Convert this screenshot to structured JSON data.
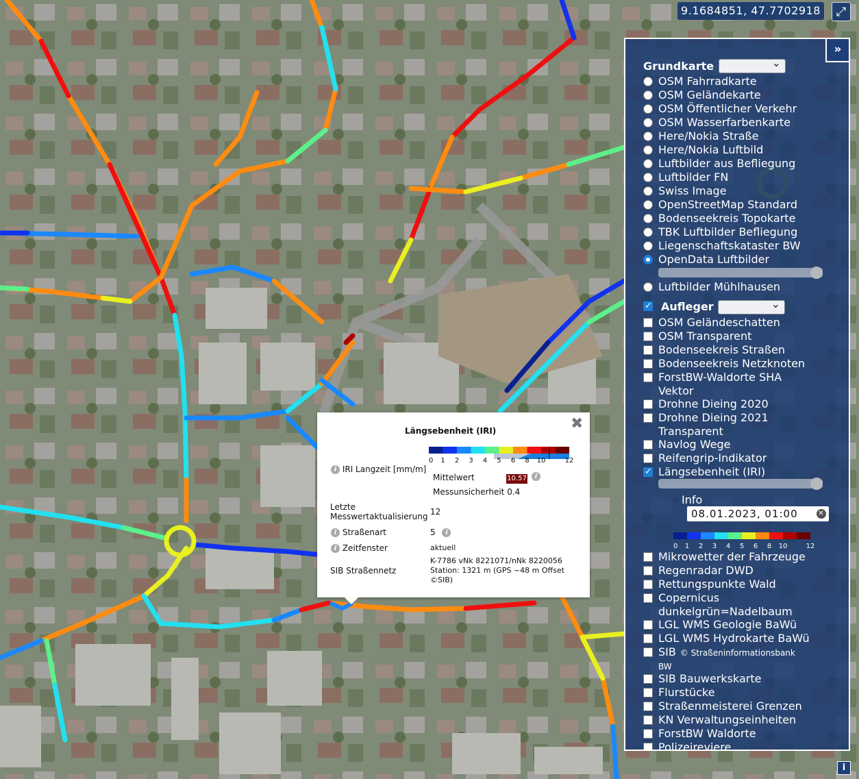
{
  "coordinates": "9.1684851, 47.7702918",
  "fullscreen_icon": "expand-icon",
  "panel": {
    "collapse_label": "»",
    "grundkarte": {
      "label": "Grundkarte",
      "selected": "OpenData Luftbilder",
      "options": [
        "OSM Fahrradkarte",
        "OSM Geländekarte",
        "OSM Öffentlicher Verkehr",
        "OSM Wasserfarbenkarte",
        "Here/Nokia Straße",
        "Here/Nokia Luftbild",
        "Luftbilder aus Befliegung",
        "Luftbilder FN",
        "Swiss Image",
        "OpenStreetMap Standard",
        "Bodenseekreis Topokarte",
        "TBK Luftbilder Befliegung",
        "Liegenschaftskataster BW",
        "OpenData Luftbilder",
        "Luftbilder Mühlhausen"
      ]
    },
    "aufleger": {
      "label": "Aufleger",
      "checked": true,
      "items": [
        {
          "label": "OSM Geländeschatten",
          "checked": false
        },
        {
          "label": "OSM Transparent",
          "checked": false
        },
        {
          "label": "Bodenseekreis Straßen",
          "checked": false
        },
        {
          "label": "Bodenseekreis Netzknoten",
          "checked": false
        },
        {
          "label": "ForstBW-Waldorte SHA",
          "label2": "Vektor",
          "checked": false
        },
        {
          "label": "Drohne Dieing 2020",
          "checked": false
        },
        {
          "label": "Drohne Dieing 2021",
          "label2": "Transparent",
          "checked": false
        },
        {
          "label": "Navlog Wege",
          "checked": false
        },
        {
          "label": "Reifengrip-Indikator",
          "checked": false
        },
        {
          "label": "Längsebenheit (IRI)",
          "checked": true
        },
        {
          "label": "Mikrowetter der Fahrzeuge",
          "checked": false
        },
        {
          "label": "Regenradar DWD",
          "checked": false
        },
        {
          "label": "Rettungspunkte Wald",
          "checked": false
        },
        {
          "label": "Copernicus",
          "label2": "dunkelgrün=Nadelbaum",
          "checked": false
        },
        {
          "label": "LGL WMS Geologie BaWü",
          "checked": false
        },
        {
          "label": "LGL WMS Hydrokarte BaWü",
          "checked": false
        },
        {
          "label": "SIB",
          "label_small": "© Straßeninformationsbank",
          "label2": "BW",
          "checked": false
        },
        {
          "label": "SIB Bauwerkskarte",
          "checked": false
        },
        {
          "label": "Flurstücke",
          "checked": false
        },
        {
          "label": "Straßenmeisterei Grenzen",
          "checked": false
        },
        {
          "label": "KN Verwaltungseinheiten",
          "checked": false
        },
        {
          "label": "ForstBW Waldorte",
          "checked": false
        },
        {
          "label": "Polizeireviere",
          "checked": false
        }
      ]
    },
    "iri_info_label": "Info",
    "datetime": "08.01.2023, 01:00",
    "legend_ticks": [
      "0",
      "1",
      "2",
      "3",
      "4",
      "5",
      "6",
      "8",
      "10",
      "12"
    ]
  },
  "legend_colors": [
    "#0a1f8f",
    "#1133ee",
    "#1a88ff",
    "#22e0f0",
    "#5cf08a",
    "#e8f020",
    "#ff8c10",
    "#ee1010",
    "#b00000",
    "#6a0000"
  ],
  "popup": {
    "title": "Längsebenheit (IRI)",
    "close_icon": "close-icon",
    "iri_label": "IRI Langzeit [mm/m]",
    "mittelwert_label": "Mittelwert",
    "mittelwert_value": "10.57",
    "messunsicherheit_label": "Messunsicherheit",
    "messunsicherheit_value": "0.4",
    "update_label1": "Letzte",
    "update_label2": "Messwertaktualisierung",
    "update_value": "12",
    "strassenart_label": "Straßenart",
    "strassenart_value": "5",
    "zeitfenster_label": "Zeitfenster",
    "zeitfenster_value": "aktuell",
    "sib_label": "SIB Straßennetz",
    "sib_line1": "K-7786 vNk 8221071/nNk 8220056",
    "sib_line2": "Station: 1321 m (GPS ~48 m Offset",
    "sib_line3": "©SIB)",
    "legend_ticks": [
      "0",
      "1",
      "2",
      "3",
      "4",
      "5",
      "6",
      "8",
      "10",
      "12"
    ]
  },
  "info_button": "i"
}
